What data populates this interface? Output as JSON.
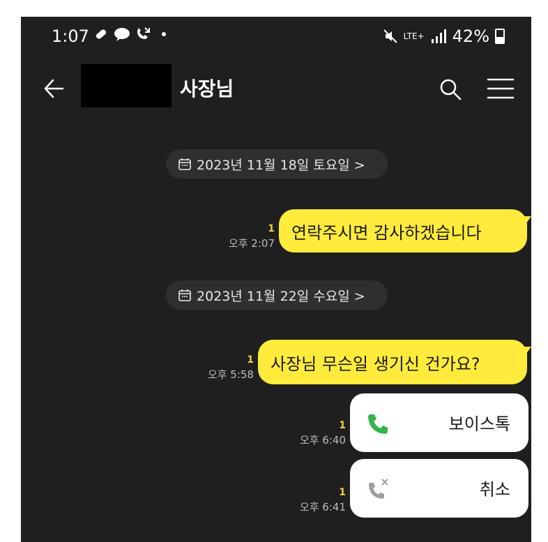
{
  "status_bar": {
    "time": "1:07",
    "network": "LTE+",
    "battery": "42%"
  },
  "header": {
    "title": "사장님"
  },
  "dates": [
    {
      "label": "2023년 11월 18일 토요일 >"
    },
    {
      "label": "2023년 11월 22일 수요일 >"
    }
  ],
  "messages": [
    {
      "text": "연락주시면 감사하겠습니다",
      "unread": "1",
      "time": "오후 2:07"
    },
    {
      "text": "사장님 무슨일 생기신 건가요?",
      "unread": "1",
      "time": "오후 5:58"
    }
  ],
  "calls": [
    {
      "label": "보이스톡",
      "unread": "1",
      "time": "오후 6:40",
      "icon": "phone-icon",
      "color": "#34b34a"
    },
    {
      "label": "취소",
      "unread": "1",
      "time": "오후 6:41",
      "icon": "phone-cancelled-icon",
      "color": "#9e9e9e"
    }
  ],
  "colors": {
    "background": "#1f1f1f",
    "bubble": "#ffeb3b",
    "unread": "#f3d23a"
  }
}
